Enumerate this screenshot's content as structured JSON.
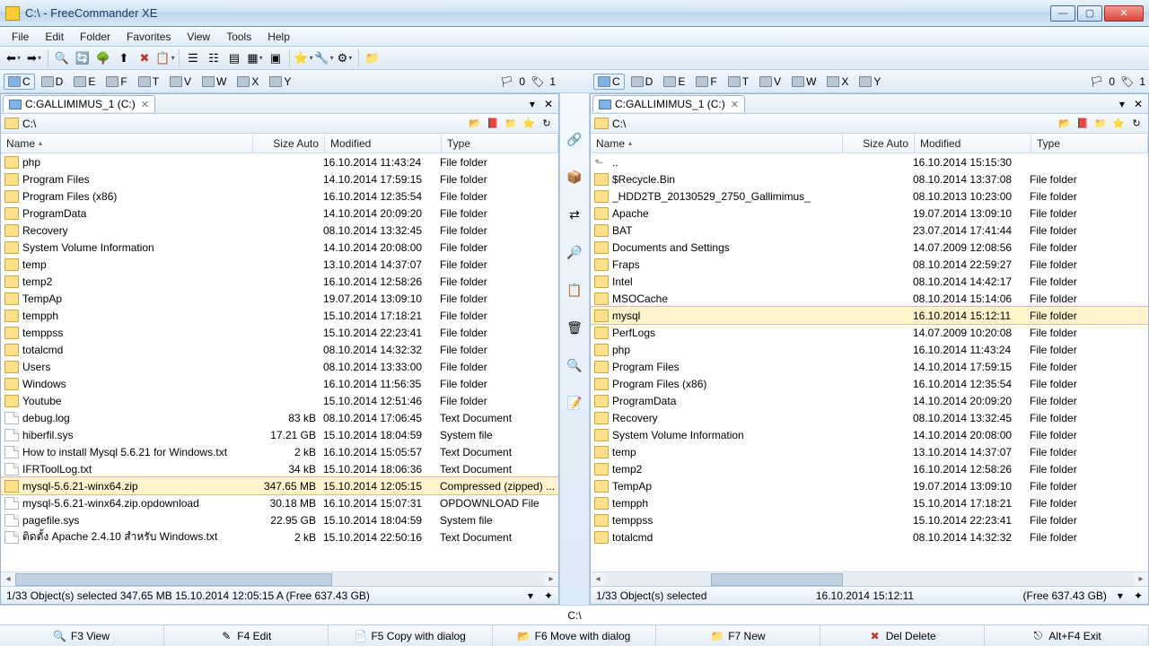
{
  "window": {
    "title": "C:\\ - FreeCommander XE"
  },
  "menu": [
    "File",
    "Edit",
    "Folder",
    "Favorites",
    "View",
    "Tools",
    "Help"
  ],
  "drives": {
    "letters": [
      "C",
      "D",
      "E",
      "F",
      "T",
      "V",
      "W",
      "X",
      "Y"
    ],
    "stats1": "0",
    "stats2": "1"
  },
  "columns": {
    "name": "Name",
    "size": "Size Auto",
    "modified": "Modified",
    "type": "Type"
  },
  "left": {
    "tab": "C:GALLIMIMUS_1 (C:)",
    "path": "C:\\",
    "status": "1/33 Object(s) selected   347.65 MB   15.10.2014 12:05:15   A   (Free 637.43 GB)",
    "rows": [
      {
        "t": "folder",
        "n": "php",
        "s": "",
        "m": "16.10.2014 11:43:24",
        "y": "File folder"
      },
      {
        "t": "folder",
        "n": "Program Files",
        "s": "",
        "m": "14.10.2014 17:59:15",
        "y": "File folder"
      },
      {
        "t": "folder",
        "n": "Program Files (x86)",
        "s": "",
        "m": "16.10.2014 12:35:54",
        "y": "File folder"
      },
      {
        "t": "folder",
        "n": "ProgramData",
        "s": "",
        "m": "14.10.2014 20:09:20",
        "y": "File folder"
      },
      {
        "t": "folder",
        "n": "Recovery",
        "s": "",
        "m": "08.10.2014 13:32:45",
        "y": "File folder"
      },
      {
        "t": "folder",
        "n": "System Volume Information",
        "s": "",
        "m": "14.10.2014 20:08:00",
        "y": "File folder"
      },
      {
        "t": "folder",
        "n": "temp",
        "s": "",
        "m": "13.10.2014 14:37:07",
        "y": "File folder"
      },
      {
        "t": "folder",
        "n": "temp2",
        "s": "",
        "m": "16.10.2014 12:58:26",
        "y": "File folder"
      },
      {
        "t": "folder",
        "n": "TempAp",
        "s": "",
        "m": "19.07.2014 13:09:10",
        "y": "File folder"
      },
      {
        "t": "folder",
        "n": "tempph",
        "s": "",
        "m": "15.10.2014 17:18:21",
        "y": "File folder"
      },
      {
        "t": "folder",
        "n": "temppss",
        "s": "",
        "m": "15.10.2014 22:23:41",
        "y": "File folder"
      },
      {
        "t": "folder",
        "n": "totalcmd",
        "s": "",
        "m": "08.10.2014 14:32:32",
        "y": "File folder"
      },
      {
        "t": "folder",
        "n": "Users",
        "s": "",
        "m": "08.10.2014 13:33:00",
        "y": "File folder"
      },
      {
        "t": "folder",
        "n": "Windows",
        "s": "",
        "m": "16.10.2014 11:56:35",
        "y": "File folder"
      },
      {
        "t": "folder",
        "n": "Youtube",
        "s": "",
        "m": "15.10.2014 12:51:46",
        "y": "File folder"
      },
      {
        "t": "file",
        "n": "debug.log",
        "s": "83 kB",
        "m": "08.10.2014 17:06:45",
        "y": "Text Document"
      },
      {
        "t": "file",
        "n": "hiberfil.sys",
        "s": "17.21 GB",
        "m": "15.10.2014 18:04:59",
        "y": "System file"
      },
      {
        "t": "file",
        "n": "How to install Mysql 5.6.21 for Windows.txt",
        "s": "2 kB",
        "m": "16.10.2014 15:05:57",
        "y": "Text Document"
      },
      {
        "t": "file",
        "n": "IFRToolLog.txt",
        "s": "34 kB",
        "m": "15.10.2014 18:06:36",
        "y": "Text Document"
      },
      {
        "t": "zip",
        "n": "mysql-5.6.21-winx64.zip",
        "s": "347.65 MB",
        "m": "15.10.2014 12:05:15",
        "y": "Compressed (zipped) ...",
        "sel": true
      },
      {
        "t": "file",
        "n": "mysql-5.6.21-winx64.zip.opdownload",
        "s": "30.18 MB",
        "m": "16.10.2014 15:07:31",
        "y": "OPDOWNLOAD File"
      },
      {
        "t": "file",
        "n": "pagefile.sys",
        "s": "22.95 GB",
        "m": "15.10.2014 18:04:59",
        "y": "System file"
      },
      {
        "t": "file",
        "n": "ติดตั้ง Apache 2.4.10 สำหรับ Windows.txt",
        "s": "2 kB",
        "m": "15.10.2014 22:50:16",
        "y": "Text Document"
      }
    ]
  },
  "right": {
    "tab": "C:GALLIMIMUS_1 (C:)",
    "path": "C:\\",
    "status_left": "1/33 Object(s) selected",
    "status_mid": "16.10.2014 15:12:11",
    "status_right": "(Free 637.43 GB)",
    "rows": [
      {
        "t": "up",
        "n": "..",
        "s": "",
        "m": "16.10.2014 15:15:30",
        "y": ""
      },
      {
        "t": "folder",
        "n": "$Recycle.Bin",
        "s": "",
        "m": "08.10.2014 13:37:08",
        "y": "File folder"
      },
      {
        "t": "folder",
        "n": "_HDD2TB_20130529_2750_Gallimimus_",
        "s": "",
        "m": "08.10.2013 10:23:00",
        "y": "File folder"
      },
      {
        "t": "folder",
        "n": "Apache",
        "s": "",
        "m": "19.07.2014 13:09:10",
        "y": "File folder"
      },
      {
        "t": "folder",
        "n": "BAT",
        "s": "",
        "m": "23.07.2014 17:41:44",
        "y": "File folder"
      },
      {
        "t": "folder",
        "n": "Documents and Settings",
        "s": "",
        "m": "14.07.2009 12:08:56",
        "y": "File folder"
      },
      {
        "t": "folder",
        "n": "Fraps",
        "s": "",
        "m": "08.10.2014 22:59:27",
        "y": "File folder"
      },
      {
        "t": "folder",
        "n": "Intel",
        "s": "",
        "m": "08.10.2014 14:42:17",
        "y": "File folder"
      },
      {
        "t": "folder",
        "n": "MSOCache",
        "s": "",
        "m": "08.10.2014 15:14:06",
        "y": "File folder"
      },
      {
        "t": "folder",
        "n": "mysql",
        "s": "",
        "m": "16.10.2014 15:12:11",
        "y": "File folder",
        "sel": true
      },
      {
        "t": "folder",
        "n": "PerfLogs",
        "s": "",
        "m": "14.07.2009 10:20:08",
        "y": "File folder"
      },
      {
        "t": "folder",
        "n": "php",
        "s": "",
        "m": "16.10.2014 11:43:24",
        "y": "File folder"
      },
      {
        "t": "folder",
        "n": "Program Files",
        "s": "",
        "m": "14.10.2014 17:59:15",
        "y": "File folder"
      },
      {
        "t": "folder",
        "n": "Program Files (x86)",
        "s": "",
        "m": "16.10.2014 12:35:54",
        "y": "File folder"
      },
      {
        "t": "folder",
        "n": "ProgramData",
        "s": "",
        "m": "14.10.2014 20:09:20",
        "y": "File folder"
      },
      {
        "t": "folder",
        "n": "Recovery",
        "s": "",
        "m": "08.10.2014 13:32:45",
        "y": "File folder"
      },
      {
        "t": "folder",
        "n": "System Volume Information",
        "s": "",
        "m": "14.10.2014 20:08:00",
        "y": "File folder"
      },
      {
        "t": "folder",
        "n": "temp",
        "s": "",
        "m": "13.10.2014 14:37:07",
        "y": "File folder"
      },
      {
        "t": "folder",
        "n": "temp2",
        "s": "",
        "m": "16.10.2014 12:58:26",
        "y": "File folder"
      },
      {
        "t": "folder",
        "n": "TempAp",
        "s": "",
        "m": "19.07.2014 13:09:10",
        "y": "File folder"
      },
      {
        "t": "folder",
        "n": "tempph",
        "s": "",
        "m": "15.10.2014 17:18:21",
        "y": "File folder"
      },
      {
        "t": "folder",
        "n": "temppss",
        "s": "",
        "m": "15.10.2014 22:23:41",
        "y": "File folder"
      },
      {
        "t": "folder",
        "n": "totalcmd",
        "s": "",
        "m": "08.10.2014 14:32:32",
        "y": "File folder"
      }
    ]
  },
  "footer_path": "C:\\",
  "fnkeys": [
    {
      "icon": "🔍",
      "label": "F3 View"
    },
    {
      "icon": "✎",
      "label": "F4 Edit"
    },
    {
      "icon": "📄",
      "label": "F5 Copy with dialog"
    },
    {
      "icon": "📂",
      "label": "F6 Move with dialog"
    },
    {
      "icon": "📁",
      "label": "F7 New"
    },
    {
      "icon": "✖",
      "label": "Del Delete",
      "red": true
    },
    {
      "icon": "⎋",
      "label": "Alt+F4 Exit"
    }
  ]
}
